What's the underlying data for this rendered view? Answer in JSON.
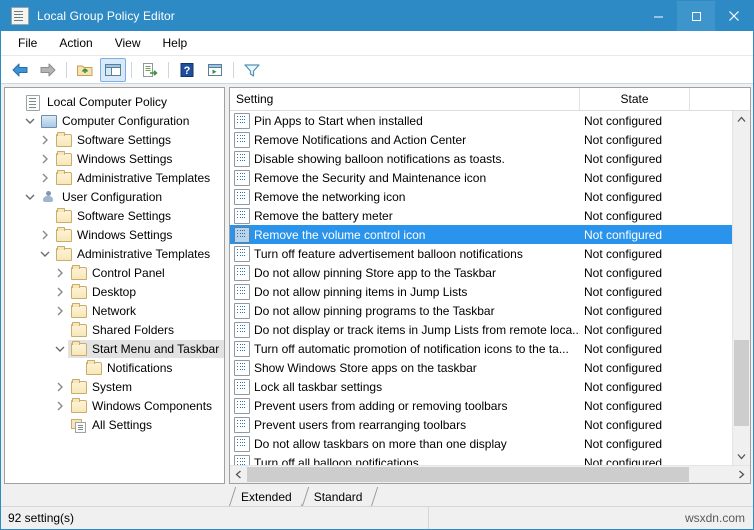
{
  "window": {
    "title": "Local Group Policy Editor",
    "title_icon": "policy-document-icon",
    "minimize_label": "–",
    "maximize_label": "□",
    "close_label": "✕"
  },
  "menubar": {
    "items": [
      {
        "label": "File"
      },
      {
        "label": "Action"
      },
      {
        "label": "View"
      },
      {
        "label": "Help"
      }
    ]
  },
  "toolbar": {
    "buttons": [
      {
        "name": "back-icon",
        "title": "Back"
      },
      {
        "name": "forward-icon",
        "title": "Forward"
      },
      {
        "name": "up-one-level-icon",
        "title": "Up One Level"
      },
      {
        "name": "show-hide-console-tree-icon",
        "title": "Show/Hide Console Tree",
        "active": true
      },
      {
        "name": "export-list-icon",
        "title": "Export List"
      },
      {
        "name": "help-icon",
        "title": "Help"
      },
      {
        "name": "properties-icon",
        "title": "Properties"
      },
      {
        "name": "filter-icon",
        "title": "Filter"
      }
    ]
  },
  "tree": {
    "nodes": [
      {
        "label": "Local Computer Policy",
        "indent": 0,
        "twisty": "none",
        "icon": "scroll-document-icon",
        "selected": false
      },
      {
        "label": "Computer Configuration",
        "indent": 1,
        "twisty": "expanded",
        "icon": "computer-icon",
        "selected": false
      },
      {
        "label": "Software Settings",
        "indent": 2,
        "twisty": "collapsed",
        "icon": "folder-icon",
        "selected": false
      },
      {
        "label": "Windows Settings",
        "indent": 2,
        "twisty": "collapsed",
        "icon": "folder-icon",
        "selected": false
      },
      {
        "label": "Administrative Templates",
        "indent": 2,
        "twisty": "collapsed",
        "icon": "folder-icon",
        "selected": false
      },
      {
        "label": "User Configuration",
        "indent": 1,
        "twisty": "expanded",
        "icon": "user-icon",
        "selected": false
      },
      {
        "label": "Software Settings",
        "indent": 2,
        "twisty": "none",
        "icon": "folder-icon",
        "selected": false
      },
      {
        "label": "Windows Settings",
        "indent": 2,
        "twisty": "collapsed",
        "icon": "folder-icon",
        "selected": false
      },
      {
        "label": "Administrative Templates",
        "indent": 2,
        "twisty": "expanded",
        "icon": "folder-icon",
        "selected": false
      },
      {
        "label": "Control Panel",
        "indent": 3,
        "twisty": "collapsed",
        "icon": "folder-icon",
        "selected": false
      },
      {
        "label": "Desktop",
        "indent": 3,
        "twisty": "collapsed",
        "icon": "folder-icon",
        "selected": false
      },
      {
        "label": "Network",
        "indent": 3,
        "twisty": "collapsed",
        "icon": "folder-icon",
        "selected": false
      },
      {
        "label": "Shared Folders",
        "indent": 3,
        "twisty": "none",
        "icon": "folder-icon",
        "selected": false
      },
      {
        "label": "Start Menu and Taskbar",
        "indent": 3,
        "twisty": "expanded",
        "icon": "folder-icon",
        "selected": true
      },
      {
        "label": "Notifications",
        "indent": 4,
        "twisty": "none",
        "icon": "folder-icon",
        "selected": false
      },
      {
        "label": "System",
        "indent": 3,
        "twisty": "collapsed",
        "icon": "folder-icon",
        "selected": false
      },
      {
        "label": "Windows Components",
        "indent": 3,
        "twisty": "collapsed",
        "icon": "folder-icon",
        "selected": false
      },
      {
        "label": "All Settings",
        "indent": 3,
        "twisty": "none",
        "icon": "all-settings-icon",
        "selected": false
      }
    ]
  },
  "list": {
    "columns": [
      {
        "label": "Setting",
        "key": "setting"
      },
      {
        "label": "State",
        "key": "state"
      },
      {
        "label": "",
        "key": "extra"
      }
    ],
    "rows": [
      {
        "setting": "Pin Apps to Start when installed",
        "state": "Not configured",
        "selected": false
      },
      {
        "setting": "Remove Notifications and Action Center",
        "state": "Not configured",
        "selected": false
      },
      {
        "setting": "Disable showing balloon notifications as toasts.",
        "state": "Not configured",
        "selected": false
      },
      {
        "setting": "Remove the Security and Maintenance icon",
        "state": "Not configured",
        "selected": false
      },
      {
        "setting": "Remove the networking icon",
        "state": "Not configured",
        "selected": false
      },
      {
        "setting": "Remove the battery meter",
        "state": "Not configured",
        "selected": false
      },
      {
        "setting": "Remove the volume control icon",
        "state": "Not configured",
        "selected": true
      },
      {
        "setting": "Turn off feature advertisement balloon notifications",
        "state": "Not configured",
        "selected": false
      },
      {
        "setting": "Do not allow pinning Store app to the Taskbar",
        "state": "Not configured",
        "selected": false
      },
      {
        "setting": "Do not allow pinning items in Jump Lists",
        "state": "Not configured",
        "selected": false
      },
      {
        "setting": "Do not allow pinning programs to the Taskbar",
        "state": "Not configured",
        "selected": false
      },
      {
        "setting": "Do not display or track items in Jump Lists from remote loca...",
        "state": "Not configured",
        "selected": false
      },
      {
        "setting": "Turn off automatic promotion of notification icons to the ta...",
        "state": "Not configured",
        "selected": false
      },
      {
        "setting": "Show Windows Store apps on the taskbar",
        "state": "Not configured",
        "selected": false
      },
      {
        "setting": "Lock all taskbar settings",
        "state": "Not configured",
        "selected": false
      },
      {
        "setting": "Prevent users from adding or removing toolbars",
        "state": "Not configured",
        "selected": false
      },
      {
        "setting": "Prevent users from rearranging toolbars",
        "state": "Not configured",
        "selected": false
      },
      {
        "setting": "Do not allow taskbars on more than one display",
        "state": "Not configured",
        "selected": false
      },
      {
        "setting": "Turn off all balloon notifications",
        "state": "Not configured",
        "selected": false
      }
    ]
  },
  "tabs": [
    {
      "label": "Extended",
      "active": true
    },
    {
      "label": "Standard",
      "active": false
    }
  ],
  "statusbar": {
    "text": "92 setting(s)",
    "watermark": "wsxdn.com"
  },
  "colors": {
    "titlebar": "#2d8ac4",
    "selection_blue": "#2a93ec",
    "tree_selection": "#e2e2e2",
    "window_bg": "#f0f0f0"
  }
}
